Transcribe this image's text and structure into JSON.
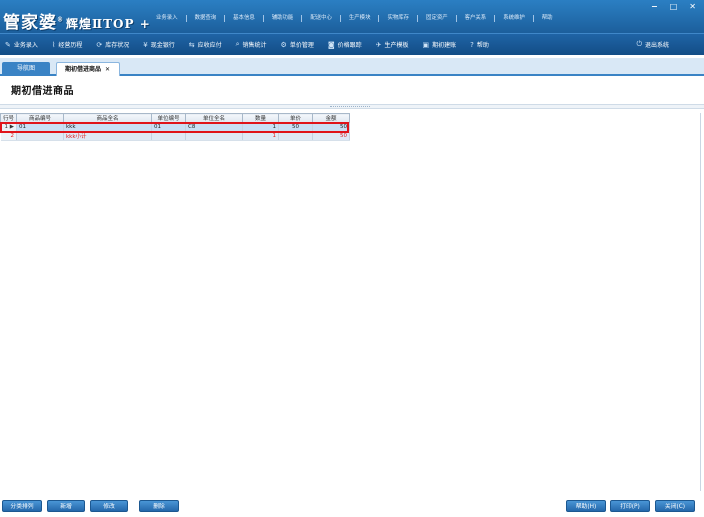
{
  "app": {
    "logo": "管家婆",
    "logo_reg": "®",
    "edition": "辉煌ⅡTOP +"
  },
  "top_menu": [
    "业务录入",
    "数据查询",
    "基本信息",
    "辅助功能",
    "配送中心",
    "生产模块",
    "实物库存",
    "固定资产",
    "客户关系",
    "系统维护",
    "帮助"
  ],
  "window_buttons": [
    "−",
    "□",
    "✕"
  ],
  "toolbar": [
    {
      "icon": "pen-icon",
      "glyph": "✎",
      "label": "业务录入"
    },
    {
      "icon": "chart-icon",
      "glyph": "⌇",
      "label": "经营历程"
    },
    {
      "icon": "inventory-icon",
      "glyph": "⟳",
      "label": "库存状况"
    },
    {
      "icon": "bank-icon",
      "glyph": "¥",
      "label": "现金银行"
    },
    {
      "icon": "transfer-icon",
      "glyph": "⇆",
      "label": "应收应付"
    },
    {
      "icon": "search-icon",
      "glyph": "⌕",
      "label": "销售统计"
    },
    {
      "icon": "gear-icon",
      "glyph": "⚙",
      "label": "单价管理"
    },
    {
      "icon": "trend-icon",
      "glyph": "◙",
      "label": "价格跟踪"
    },
    {
      "icon": "wrench-icon",
      "glyph": "✈",
      "label": "生产模板"
    },
    {
      "icon": "edit-icon",
      "glyph": "▣",
      "label": "期初建账"
    },
    {
      "icon": "help-icon",
      "glyph": "?",
      "label": "帮助"
    },
    {
      "icon": "power-icon",
      "glyph": "⏻",
      "label": "退出系统"
    }
  ],
  "tabs": {
    "nav": "导航图",
    "current": "期初借进商品",
    "close": "✕"
  },
  "page_title": "期初借进商品",
  "grid": {
    "columns": [
      "行号",
      "商品编号",
      "商品全名",
      "单位编号",
      "单位全名",
      "数量",
      "单价",
      "金额"
    ],
    "rows": [
      {
        "row_no": "1",
        "marker": "▶",
        "code": "01",
        "name": "kkk",
        "unit_code": "01",
        "unit_name": "C8",
        "qty": "1",
        "price": "50",
        "amount": "50"
      },
      {
        "row_no": "2",
        "marker": "",
        "code": "",
        "name": "kkk小计",
        "unit_code": "",
        "unit_name": "",
        "qty": "1",
        "price": "",
        "amount": "50"
      }
    ]
  },
  "buttons": {
    "sort": "分类排列",
    "add": "新增",
    "modify": "修改",
    "delete": "删除",
    "help": "帮助(H)",
    "print": "打印(P)",
    "close": "关闭(C)"
  }
}
